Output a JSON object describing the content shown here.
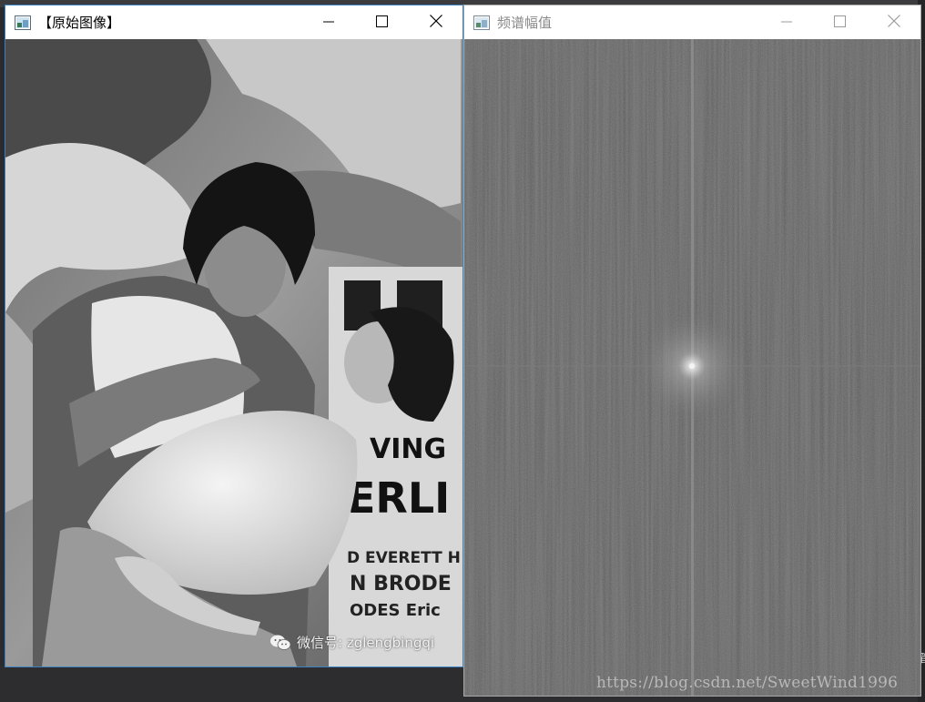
{
  "windows": {
    "original": {
      "title": "【原始图像】",
      "watermark": "微信号: zglengbingqi",
      "poster_text": {
        "line1": "VING",
        "line2": "ERLI",
        "line3": "D EVERETT H",
        "line4": "N BRODE",
        "line5": "ODES Eric"
      }
    },
    "spectrum": {
      "title": "频谱幅值",
      "watermark": "https://blog.csdn.net/SweetWind1996"
    }
  },
  "background": {
    "edge_char": "管"
  },
  "icons": {
    "app": "image-window-icon",
    "minimize": "minimize-icon",
    "maximize": "maximize-icon",
    "close": "close-icon",
    "wechat": "wechat-icon"
  },
  "colors": {
    "active_border": "#3b82c4",
    "inactive_title": "#8a8a8a",
    "spectrum_background": "#545454"
  }
}
